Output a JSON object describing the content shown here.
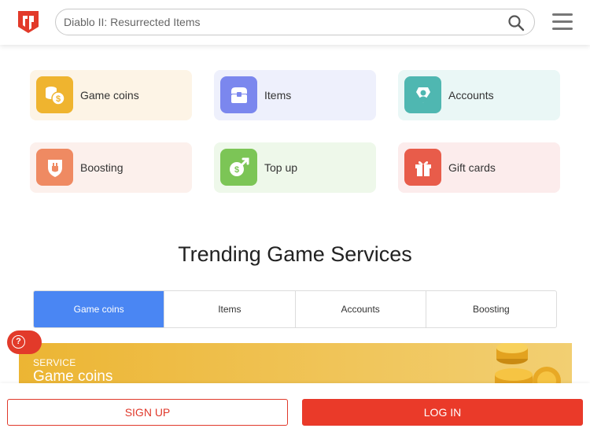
{
  "search": {
    "placeholder": "Diablo II: Resurrected Items"
  },
  "categories": [
    {
      "label": "Game coins",
      "icon": "coins-icon",
      "bg": "#fdf4e6",
      "icon_bg": "#efb42f"
    },
    {
      "label": "Items",
      "icon": "chest-icon",
      "bg": "#eef0fc",
      "icon_bg": "#7b87ee"
    },
    {
      "label": "Accounts",
      "icon": "account-icon",
      "bg": "#eaf7f6",
      "icon_bg": "#4fb7b1"
    },
    {
      "label": "Boosting",
      "icon": "boosting-icon",
      "bg": "#fcf0ec",
      "icon_bg": "#ef8a62"
    },
    {
      "label": "Top up",
      "icon": "topup-icon",
      "bg": "#eef8ea",
      "icon_bg": "#7cc556"
    },
    {
      "label": "Gift cards",
      "icon": "gift-icon",
      "bg": "#fcecec",
      "icon_bg": "#e85c4a"
    }
  ],
  "trending": {
    "title": "Trending Game Services",
    "tabs": [
      "Game coins",
      "Items",
      "Accounts",
      "Boosting"
    ],
    "active_tab": "Game coins",
    "active_color": "#4a86f3"
  },
  "banner": {
    "kicker": "SERVICE",
    "headline": "Game coins"
  },
  "help": {
    "icon": "question-icon"
  },
  "auth": {
    "signup": "SIGN UP",
    "login": "LOG IN",
    "accent": "#ea3a29"
  }
}
